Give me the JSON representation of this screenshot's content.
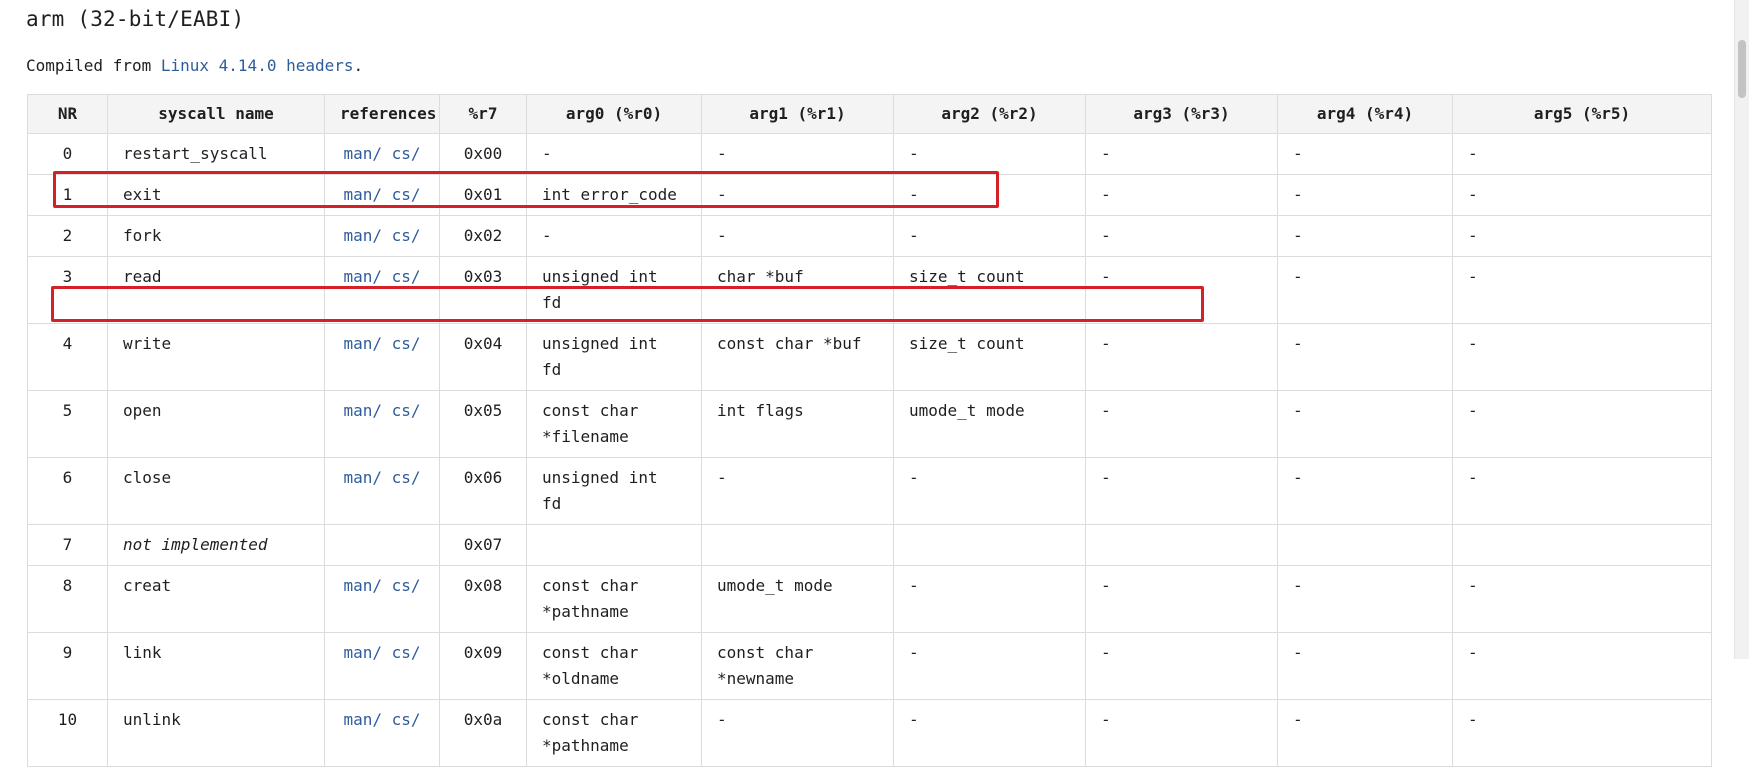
{
  "page": {
    "title": "arm (32-bit/EABI)",
    "intro_prefix": "Compiled from ",
    "intro_link": "Linux 4.14.0 headers",
    "intro_suffix": "."
  },
  "table": {
    "headers": [
      "NR",
      "syscall name",
      "references",
      "%r7",
      "arg0 (%r0)",
      "arg1 (%r1)",
      "arg2 (%r2)",
      "arg3 (%r3)",
      "arg4 (%r4)",
      "arg5 (%r5)"
    ],
    "ref_man": "man/",
    "ref_cs": "cs/",
    "rows": [
      {
        "nr": "0",
        "name": "restart_syscall",
        "reg": "0x00",
        "args": [
          "-",
          "-",
          "-",
          "-",
          "-",
          "-"
        ]
      },
      {
        "nr": "1",
        "name": "exit",
        "reg": "0x01",
        "args": [
          "int error_code",
          "-",
          "-",
          "-",
          "-",
          "-"
        ]
      },
      {
        "nr": "2",
        "name": "fork",
        "reg": "0x02",
        "args": [
          "-",
          "-",
          "-",
          "-",
          "-",
          "-"
        ]
      },
      {
        "nr": "3",
        "name": "read",
        "reg": "0x03",
        "args": [
          "unsigned int fd",
          "char *buf",
          "size_t count",
          "-",
          "-",
          "-"
        ]
      },
      {
        "nr": "4",
        "name": "write",
        "reg": "0x04",
        "args": [
          "unsigned int fd",
          "const char *buf",
          "size_t count",
          "-",
          "-",
          "-"
        ]
      },
      {
        "nr": "5",
        "name": "open",
        "reg": "0x05",
        "args": [
          "const char *filename",
          "int flags",
          "umode_t mode",
          "-",
          "-",
          "-"
        ]
      },
      {
        "nr": "6",
        "name": "close",
        "reg": "0x06",
        "args": [
          "unsigned int fd",
          "-",
          "-",
          "-",
          "-",
          "-"
        ]
      },
      {
        "nr": "7",
        "name": "not implemented",
        "reg": "0x07",
        "args": [
          "",
          "",
          "",
          "",
          "",
          ""
        ]
      },
      {
        "nr": "8",
        "name": "creat",
        "reg": "0x08",
        "args": [
          "const char *pathname",
          "umode_t mode",
          "-",
          "-",
          "-",
          "-"
        ]
      },
      {
        "nr": "9",
        "name": "link",
        "reg": "0x09",
        "args": [
          "const char *oldname",
          "const char *newname",
          "-",
          "-",
          "-",
          "-"
        ]
      },
      {
        "nr": "10",
        "name": "unlink",
        "reg": "0x0a",
        "args": [
          "const char *pathname",
          "-",
          "-",
          "-",
          "-",
          "-"
        ]
      }
    ]
  },
  "colors": {
    "link": "#2f5d9b",
    "highlight": "#d42027",
    "border": "#dcdcdc",
    "header_bg": "#f4f4f4"
  }
}
